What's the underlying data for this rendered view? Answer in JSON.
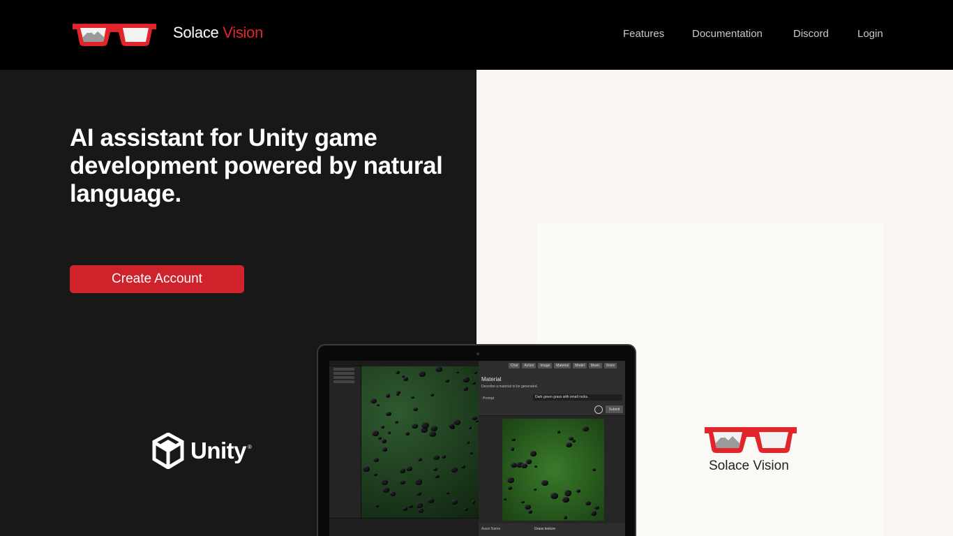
{
  "header": {
    "brand_primary": "Solace",
    "brand_accent": "Vision",
    "nav": {
      "features": "Features",
      "documentation": "Documentation",
      "discord": "Discord",
      "login": "Login"
    }
  },
  "hero": {
    "title": "AI assistant for Unity game development powered by natural language.",
    "cta": "Create Account"
  },
  "partners": {
    "unity_name": "Unity",
    "unity_mark": "®",
    "solace_label": "Solace Vision"
  },
  "laptop_screen": {
    "tabs": [
      "Chat",
      "Action",
      "Image",
      "Material",
      "Model",
      "Music",
      "Voice"
    ],
    "panel_title": "Material",
    "panel_desc": "Describe a material to be generated.",
    "prompt_label": "Prompt",
    "prompt_value": "Dark green grass with small rocks.",
    "submit_label": "Submit",
    "asset_name_label": "Asset Name",
    "asset_name_value": "Grass texture"
  },
  "colors": {
    "accent": "#e2242b",
    "cta_bg": "#d0222b",
    "left_bg": "#181818",
    "right_bg": "#f9f6f1"
  },
  "icons": {
    "logo": "red-glasses-icon",
    "unity": "unity-cube-icon"
  }
}
